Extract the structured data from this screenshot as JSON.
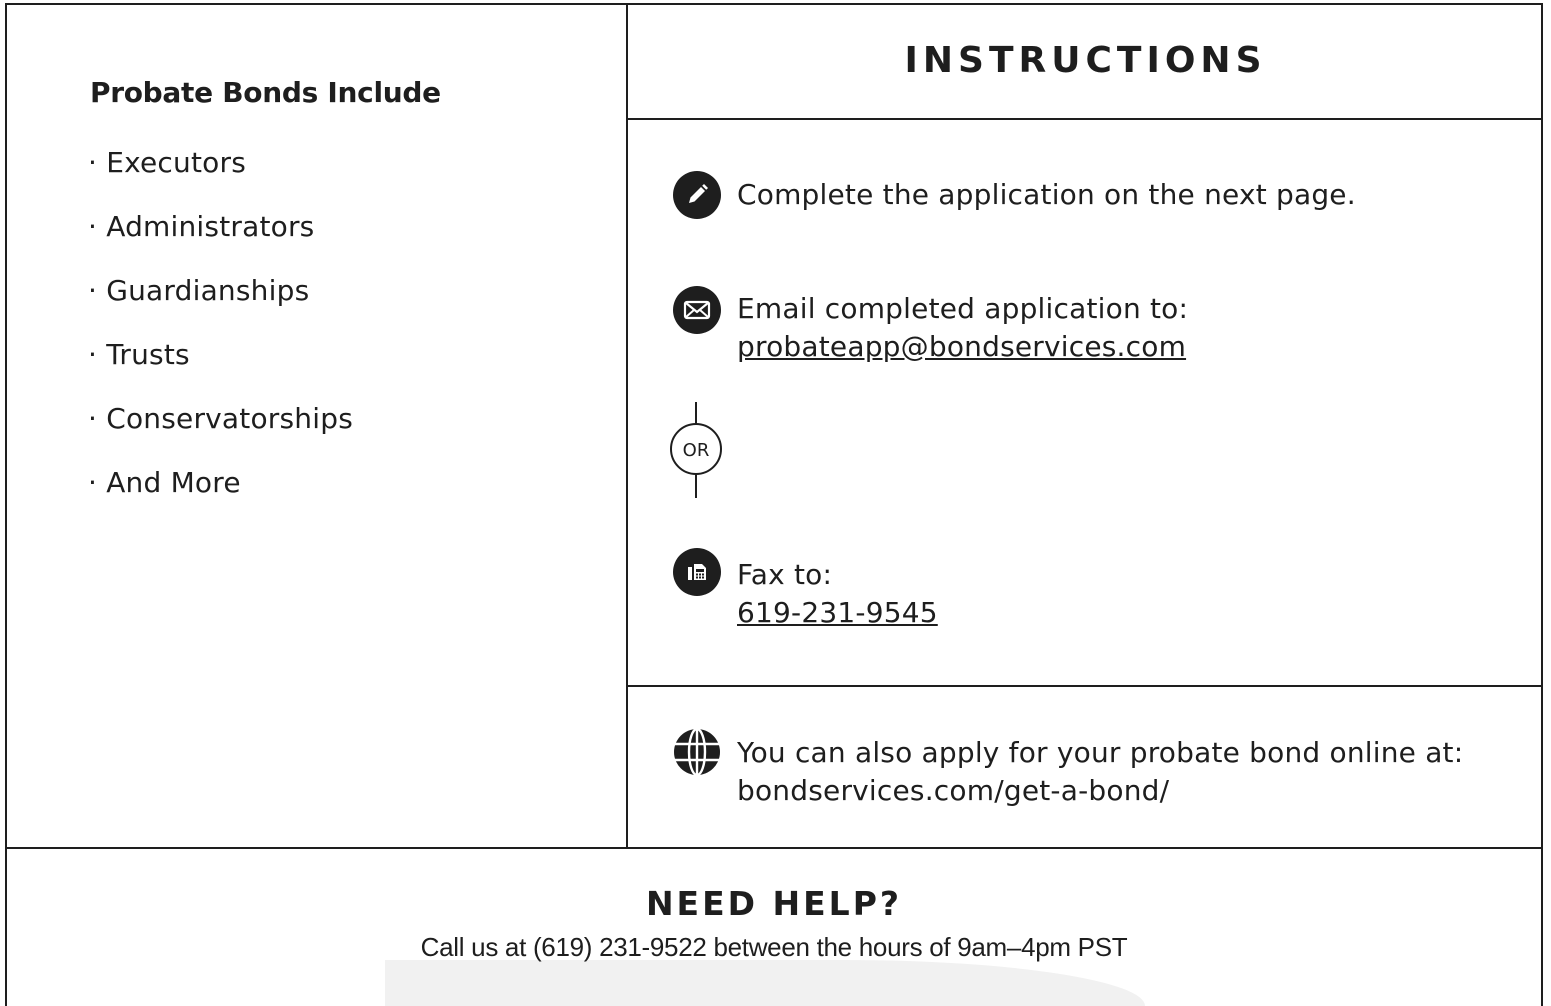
{
  "left": {
    "title": "Probate Bonds Include",
    "items": [
      "· Executors",
      "· Administrators",
      "· Guardianships",
      "· Trusts",
      "· Conservatorships",
      "· And More"
    ]
  },
  "instructions": {
    "title": "INSTRUCTIONS",
    "step1": {
      "icon": "pencil-icon",
      "text": "Complete the application on the next page."
    },
    "step2": {
      "icon": "envelope-icon",
      "line1": "Email completed application to:",
      "email": "probateapp@bondservices.com"
    },
    "or_label": "OR",
    "step3": {
      "icon": "fax-icon",
      "line1": "Fax to:",
      "fax": "619-231-9545"
    },
    "online": {
      "icon": "globe-icon",
      "line1": "You can also apply for your probate bond online at:",
      "url": "bondservices.com/get-a-bond/"
    }
  },
  "help": {
    "title": "NEED HELP?",
    "text": "Call us at  (619) 231-9522 between the hours of 9am–4pm PST"
  },
  "colors": {
    "ink": "#1e1e1e",
    "background": "#ffffff"
  }
}
